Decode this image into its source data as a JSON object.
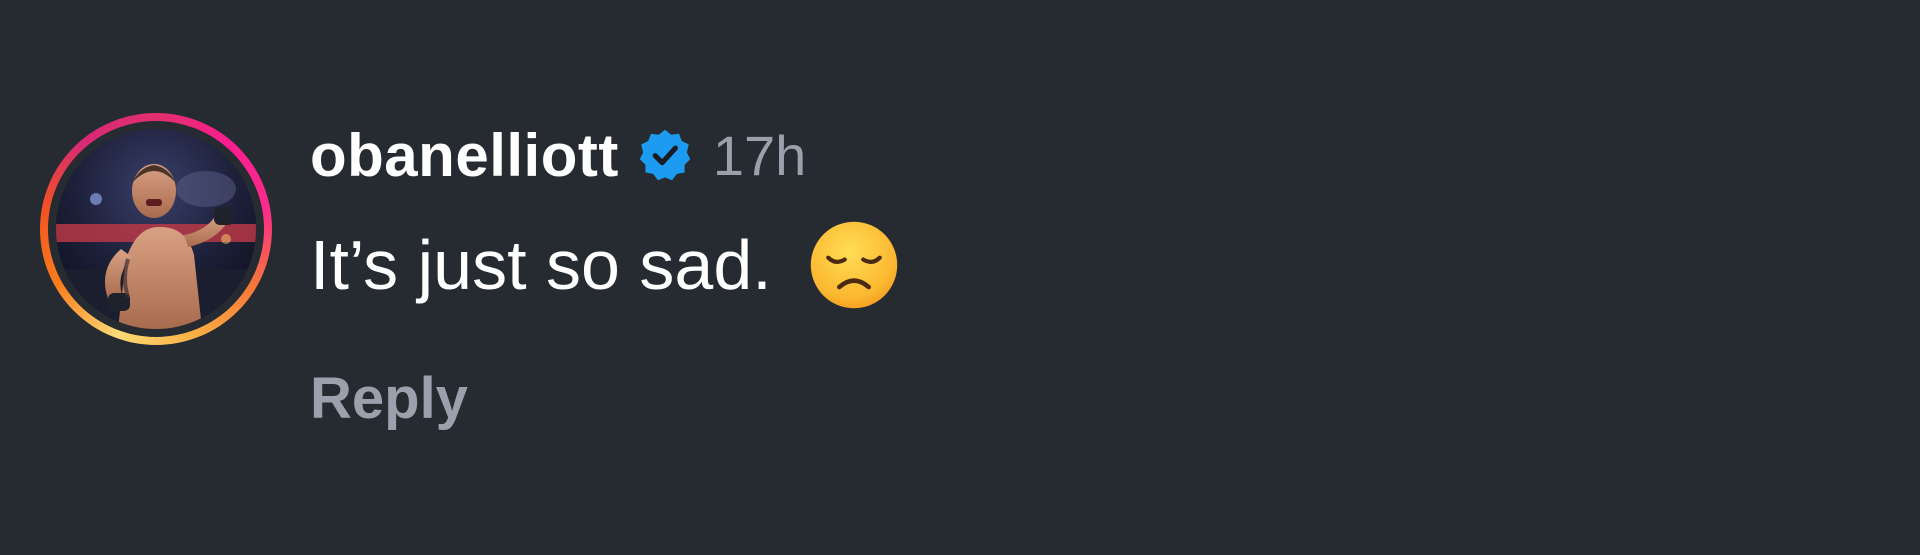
{
  "comment": {
    "username": "obanelliott",
    "verified_icon": "verified-badge-icon",
    "timestamp": "17h",
    "text": "It’s just so sad.",
    "emoji_icon": "disappointed-face-emoji",
    "reply_label": "Reply"
  },
  "colors": {
    "background": "#262a31",
    "username": "#ffffff",
    "timestamp": "#9aa1ac",
    "verified": "#1d9bf0",
    "reply": "#9aa1ac"
  }
}
